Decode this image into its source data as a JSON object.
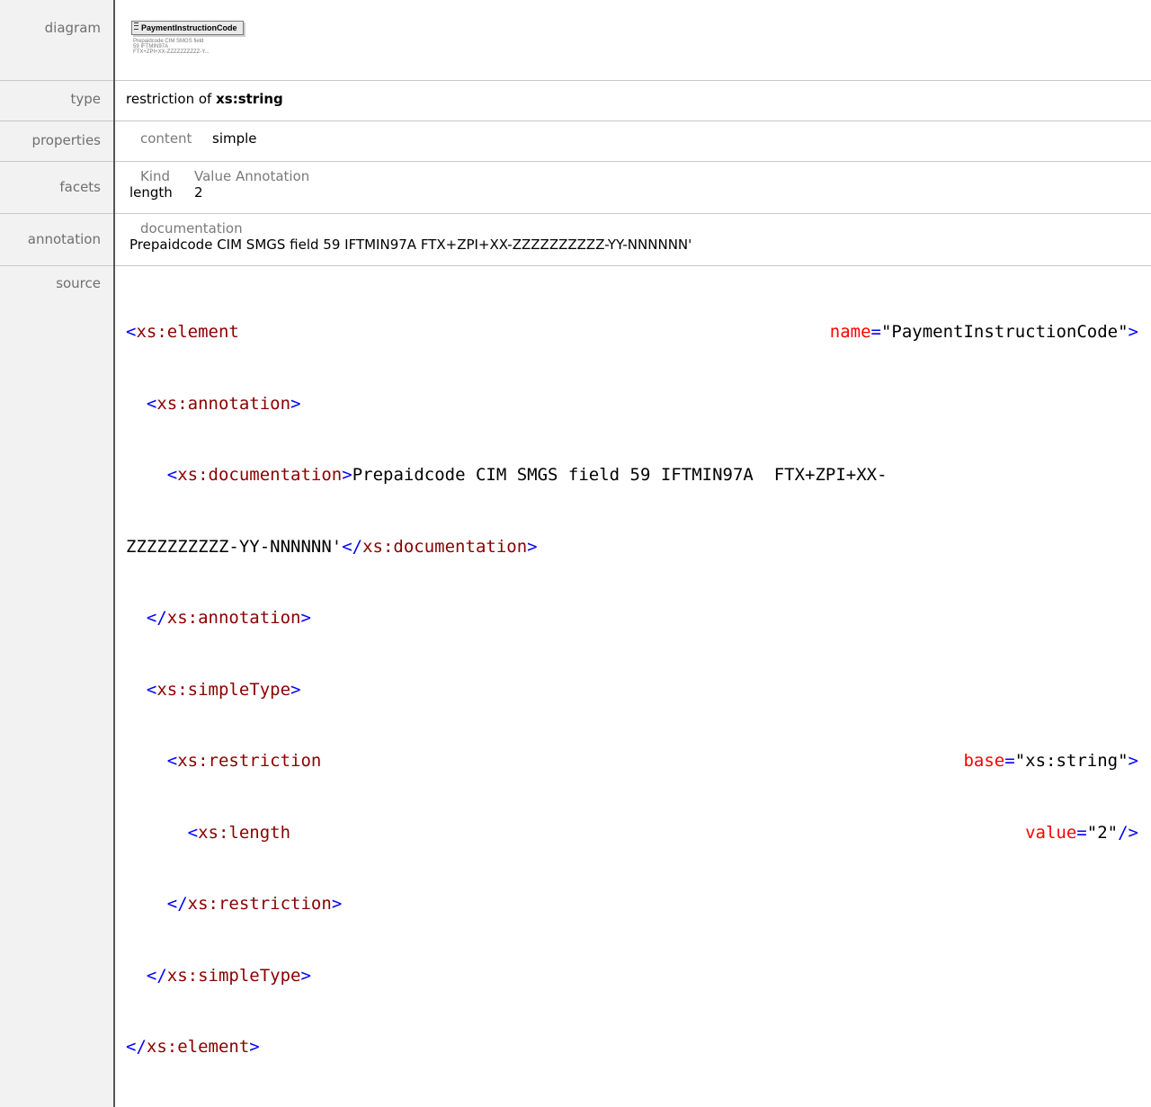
{
  "labels": {
    "diagram": "diagram",
    "type": "type",
    "properties": "properties",
    "facets": "facets",
    "annotation": "annotation",
    "source": "source"
  },
  "diagram": {
    "element_name": "PaymentInstructionCode",
    "doc_lines": [
      "Prepaidcode CIM SMGS field",
      "59 IFTMIN97A",
      "FTX+ZPI+XX-ZZZZZZZZZZ-Y..."
    ]
  },
  "type": {
    "prefix": "restriction of",
    "base": "xs:string"
  },
  "properties": {
    "key": "content",
    "value": "simple"
  },
  "facets": {
    "headers": [
      "Kind",
      "Value",
      "Annotation"
    ],
    "row": {
      "kind": "length",
      "value": "2",
      "annotation": ""
    }
  },
  "annotation": {
    "header": "documentation",
    "text": "Prepaidcode CIM SMGS field 59 IFTMIN97A  FTX+ZPI+XX-ZZZZZZZZZZ-YY-NNNNNN'"
  },
  "source": {
    "element_tag": "xs:element",
    "name_attr": "name",
    "name_value": "PaymentInstructionCode",
    "annotation_tag": "xs:annotation",
    "documentation_tag": "xs:documentation",
    "doc_text_1": "Prepaidcode CIM SMGS field 59 IFTMIN97A  FTX+ZPI+XX-",
    "doc_text_2": "ZZZZZZZZZZ-YY-NNNNNN'",
    "simpletype_tag": "xs:simpleType",
    "restriction_tag": "xs:restriction",
    "base_attr": "base",
    "base_value": "xs:string",
    "length_tag": "xs:length",
    "value_attr": "value",
    "value_value": "2"
  }
}
